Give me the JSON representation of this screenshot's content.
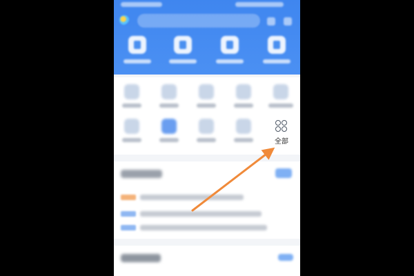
{
  "grid": {
    "all_label": "全部"
  },
  "colors": {
    "header_blue": "#4a8ef2",
    "annotation_arrow": "#f08a3a"
  },
  "icons": {
    "all": "grid-four-circles-icon"
  }
}
